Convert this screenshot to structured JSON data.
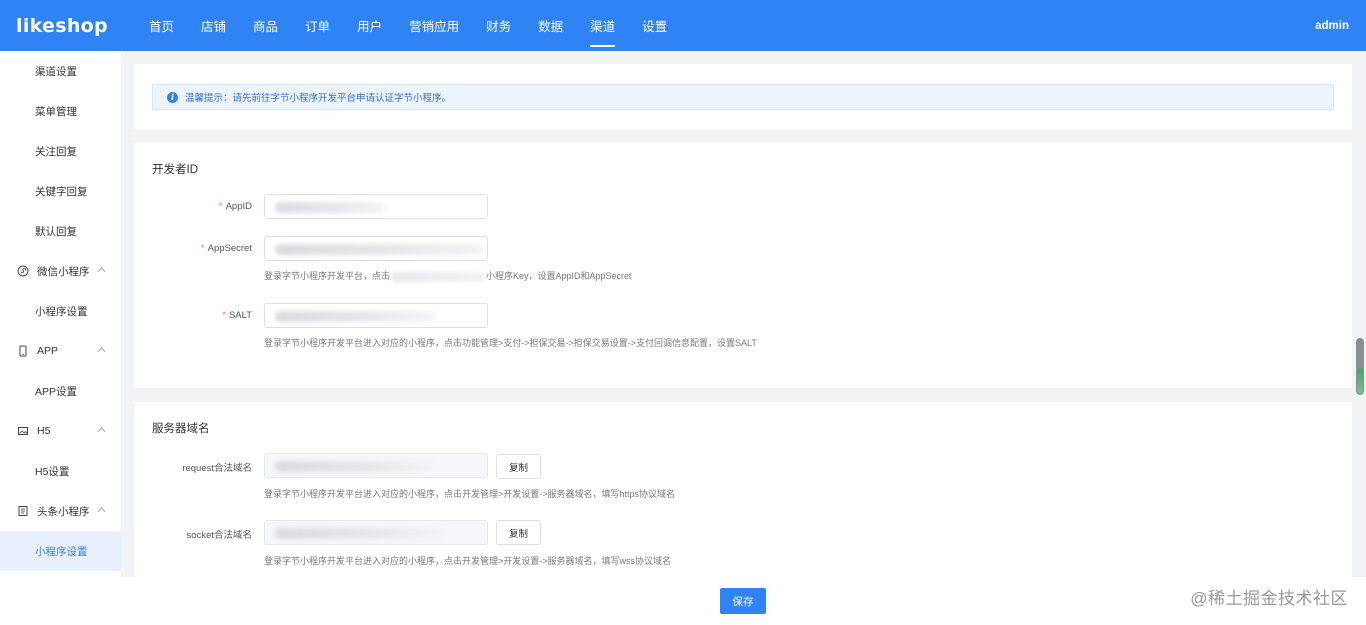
{
  "brand": {
    "logo": "likeshop",
    "admin": "admin"
  },
  "nav": [
    {
      "label": "首页"
    },
    {
      "label": "店铺"
    },
    {
      "label": "商品"
    },
    {
      "label": "订单"
    },
    {
      "label": "用户"
    },
    {
      "label": "营销应用"
    },
    {
      "label": "财务"
    },
    {
      "label": "数据"
    },
    {
      "label": "渠道",
      "active": true
    },
    {
      "label": "设置"
    }
  ],
  "sidebar": {
    "items": [
      {
        "label": "渠道设置"
      },
      {
        "label": "菜单管理"
      },
      {
        "label": "关注回复"
      },
      {
        "label": "关键字回复"
      },
      {
        "label": "默认回复"
      },
      {
        "label": "微信小程序",
        "icon": "mini-program-icon"
      },
      {
        "label": "小程序设置"
      },
      {
        "label": "APP",
        "icon": "phone-icon"
      },
      {
        "label": "APP设置"
      },
      {
        "label": "H5",
        "icon": "image-icon"
      },
      {
        "label": "H5设置"
      },
      {
        "label": "头条小程序",
        "icon": "document-icon"
      },
      {
        "label": "小程序设置"
      }
    ]
  },
  "alert": {
    "text": "温馨提示：请先前往字节小程序开发平台申请认证字节小程序。"
  },
  "developer": {
    "title": "开发者ID",
    "appid_label": "AppID",
    "appsecret_label": "AppSecret",
    "appsecret_hint_pre": "登录字节小程序开发平台，点击",
    "appsecret_hint_post": "小程序Key，设置AppID和AppSecret",
    "salt_label": "SALT",
    "salt_hint": "登录字节小程序开发平台进入对应的小程序，点击功能管理>支付->担保交易->担保交易设置->支付回调信息配置，设置SALT",
    "required_mark": "*"
  },
  "server": {
    "title": "服务器域名",
    "request_label": "request合法域名",
    "request_hint": "登录字节小程序开发平台进入对应的小程序，点击开发管理>开发设置->服务器域名，填写https协议域名",
    "socket_label": "socket合法域名",
    "socket_hint": "登录字节小程序开发平台进入对应的小程序，点击开发管理>开发设置->服务器域名，填写wss协议域名",
    "copy_label": "复制"
  },
  "footer": {
    "save_label": "保存",
    "watermark": "@稀土掘金技术社区"
  },
  "colors": {
    "primary": "#2f83f5",
    "required": "#f56c6c"
  }
}
